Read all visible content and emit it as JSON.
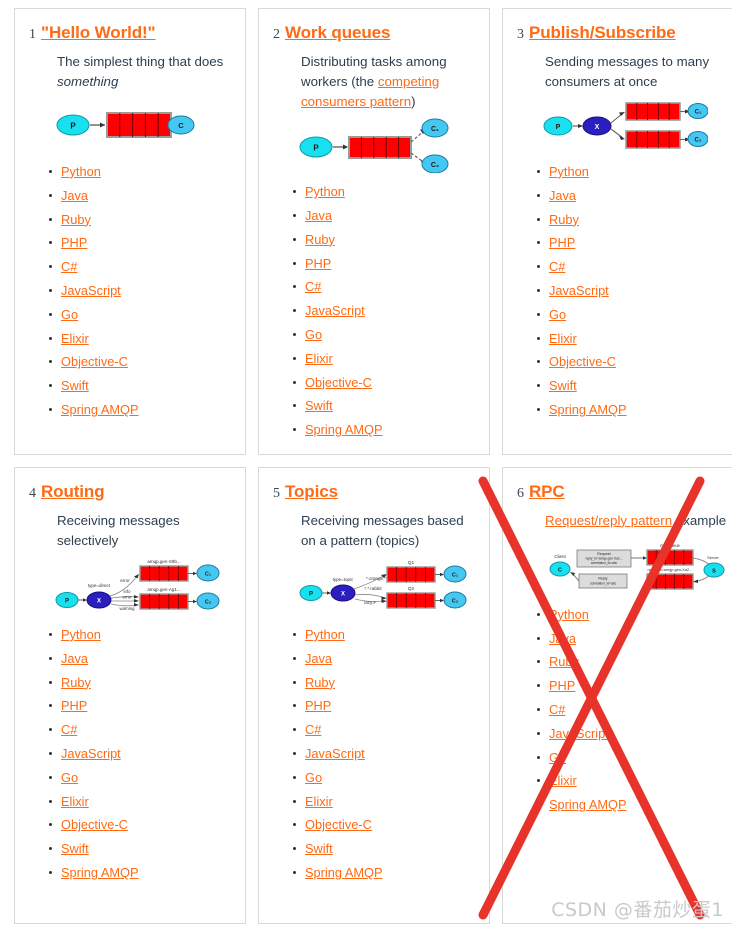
{
  "page": {
    "watermark": "CSDN @番茄炒蛋1",
    "accent_color": "#ff6a13",
    "x_overlay_color": "#e8332a",
    "border_color": "#d9d9d9"
  },
  "languages_full": [
    "Python",
    "Java",
    "Ruby",
    "PHP",
    "C#",
    "JavaScript",
    "Go",
    "Elixir",
    "Objective-C",
    "Swift",
    "Spring AMQP"
  ],
  "cards": [
    {
      "number": "1",
      "title": "\"Hello World!\"",
      "desc_plain": "The simplest thing that does ",
      "desc_italic": "something",
      "desc_tail": "",
      "link_text": "",
      "link_tail": "",
      "diagram": "hello-world",
      "languages": [
        "Python",
        "Java",
        "Ruby",
        "PHP",
        "C#",
        "JavaScript",
        "Go",
        "Elixir",
        "Objective-C",
        "Swift",
        "Spring AMQP"
      ]
    },
    {
      "number": "2",
      "title": "Work queues",
      "desc_plain": "Distributing tasks among workers (the ",
      "desc_italic": "",
      "link_text": "competing consumers pattern",
      "link_tail": ")",
      "diagram": "work-queues",
      "languages": [
        "Python",
        "Java",
        "Ruby",
        "PHP",
        "C#",
        "JavaScript",
        "Go",
        "Elixir",
        "Objective-C",
        "Swift",
        "Spring AMQP"
      ]
    },
    {
      "number": "3",
      "title": "Publish/Subscribe",
      "desc_plain": "Sending messages to many consumers at once",
      "desc_italic": "",
      "link_text": "",
      "link_tail": "",
      "diagram": "pub-sub",
      "languages": [
        "Python",
        "Java",
        "Ruby",
        "PHP",
        "C#",
        "JavaScript",
        "Go",
        "Elixir",
        "Objective-C",
        "Swift",
        "Spring AMQP"
      ]
    },
    {
      "number": "4",
      "title": "Routing",
      "desc_plain": "Receiving messages selectively",
      "desc_italic": "",
      "link_text": "",
      "link_tail": "",
      "diagram": "routing",
      "languages": [
        "Python",
        "Java",
        "Ruby",
        "PHP",
        "C#",
        "JavaScript",
        "Go",
        "Elixir",
        "Objective-C",
        "Swift",
        "Spring AMQP"
      ]
    },
    {
      "number": "5",
      "title": "Topics",
      "desc_plain": "Receiving messages based on a pattern (topics)",
      "desc_italic": "",
      "link_text": "",
      "link_tail": "",
      "diagram": "topics",
      "languages": [
        "Python",
        "Java",
        "Ruby",
        "PHP",
        "C#",
        "JavaScript",
        "Go",
        "Elixir",
        "Objective-C",
        "Swift",
        "Spring AMQP"
      ]
    },
    {
      "number": "6",
      "title": "RPC",
      "desc_plain": "",
      "desc_italic": "",
      "link_text": "Request/reply pattern",
      "link_tail": " example",
      "diagram": "rpc",
      "languages": [
        "Python",
        "Java",
        "Ruby",
        "PHP",
        "C#",
        "JavaScript",
        "Go",
        "Elixir",
        "Spring AMQP"
      ]
    }
  ],
  "diagram_labels": {
    "producer": "P",
    "consumer": "C",
    "consumer_1": "C₁",
    "consumer_2": "C₂",
    "exchange": "X",
    "routing_type_direct": "type=direct",
    "routing_key_error": "error",
    "routing_key_info": "info",
    "routing_key_warning": "warning",
    "routing_queue_1": "amqp.gen-S9b...",
    "routing_queue_2": "amqp.gen-Ag1...",
    "topic_type": "type=topic",
    "topic_key_1": "*.orange.*",
    "topic_key_2": "*.*.rabbit",
    "topic_key_3": "lazy.#",
    "topic_queue_1": "Q1",
    "topic_queue_2": "Q2",
    "rpc_client": "Client",
    "rpc_server": "Server",
    "rpc_request": "Request",
    "rpc_request_props": "reply_to=amqp.gen-Xa2...\ncorrelation_id=abc",
    "rpc_reply": "Reply",
    "rpc_reply_props": "correlation_id=abc",
    "rpc_queue": "rpc_queue",
    "rpc_reply_queue": "reply_to=amqp.gen-Xa2..."
  }
}
